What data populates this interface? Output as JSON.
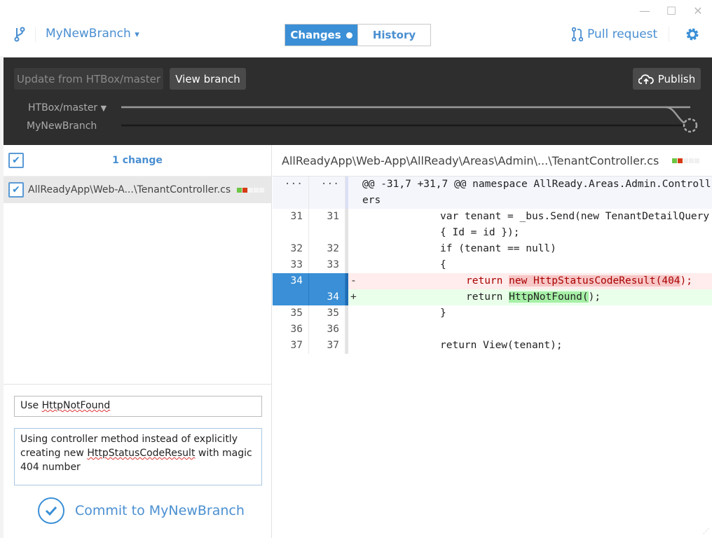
{
  "window": {
    "minimize": "—",
    "maximize": "☐",
    "close": "✕"
  },
  "header": {
    "branch_icon": "git-branch-icon",
    "branch_name": "MyNewBranch",
    "branch_caret": "▾",
    "tabs": [
      {
        "label": "Changes",
        "active": true
      },
      {
        "label": "History",
        "active": false
      }
    ],
    "pull_request": "Pull request",
    "settings_icon": "gear-icon"
  },
  "compare": {
    "update_button": "Update from HTBox/master",
    "view_branch_button": "View branch",
    "publish_button": "Publish",
    "base_branch": "HTBox/master",
    "base_caret": "▼",
    "current_branch": "MyNewBranch"
  },
  "changes": {
    "header": "1 change",
    "all_checked": true,
    "files": [
      {
        "path": "AllReadyApp\\Web-A...\\TenantController.cs",
        "checked": true
      }
    ]
  },
  "commit": {
    "summary": "Use HttpNotFound",
    "summary_pre": "Use ",
    "summary_sq": "HttpNotFound",
    "description_parts": [
      "Using controller method instead of explicitly creating new ",
      "HttpStatusCodeResult",
      " with magic 404 number"
    ],
    "button": "Commit to MyNewBranch"
  },
  "diff": {
    "path": "AllReadyApp\\Web-App\\AllReady\\Areas\\Admin\\...\\TenantController.cs",
    "colors": {
      "added": "#6cc644",
      "removed": "#d73a13",
      "neutral": "#eeeeee",
      "accent": "#3a8fd6"
    },
    "lines": [
      {
        "type": "hunk",
        "old": "···",
        "new": "···",
        "sign": "",
        "indent": 0,
        "segments": [
          {
            "t": "@@ -31,7 +31,7 @@ namespace AllReady.Areas.Admin.Controllers"
          }
        ]
      },
      {
        "type": "ctx",
        "old": "31",
        "new": "31",
        "sign": "",
        "indent": 12,
        "segments": [
          {
            "t": "var tenant = _bus.Send(new TenantDetailQuery { Id = id });"
          }
        ]
      },
      {
        "type": "ctx",
        "old": "32",
        "new": "32",
        "sign": "",
        "indent": 12,
        "segments": [
          {
            "t": "if (tenant == null)"
          }
        ]
      },
      {
        "type": "ctx",
        "old": "33",
        "new": "33",
        "sign": "",
        "indent": 12,
        "segments": [
          {
            "t": "{"
          }
        ]
      },
      {
        "type": "del",
        "old": "34",
        "new": "",
        "sign": "-",
        "indent": 16,
        "segments": [
          {
            "t": "return "
          },
          {
            "t": "new HttpStatusCodeResult(404",
            "hl": true
          },
          {
            "t": ");"
          }
        ]
      },
      {
        "type": "add",
        "old": "",
        "new": "34",
        "sign": "+",
        "indent": 16,
        "segments": [
          {
            "t": "return "
          },
          {
            "t": "HttpNotFound(",
            "hl": true
          },
          {
            "t": ");"
          }
        ]
      },
      {
        "type": "ctx",
        "old": "35",
        "new": "35",
        "sign": "",
        "indent": 12,
        "segments": [
          {
            "t": "}"
          }
        ]
      },
      {
        "type": "ctx",
        "old": "36",
        "new": "36",
        "sign": "",
        "indent": 12,
        "segments": [
          {
            "t": ""
          }
        ]
      },
      {
        "type": "ctx",
        "old": "37",
        "new": "37",
        "sign": "",
        "indent": 12,
        "segments": [
          {
            "t": "return View(tenant);"
          }
        ]
      }
    ]
  }
}
